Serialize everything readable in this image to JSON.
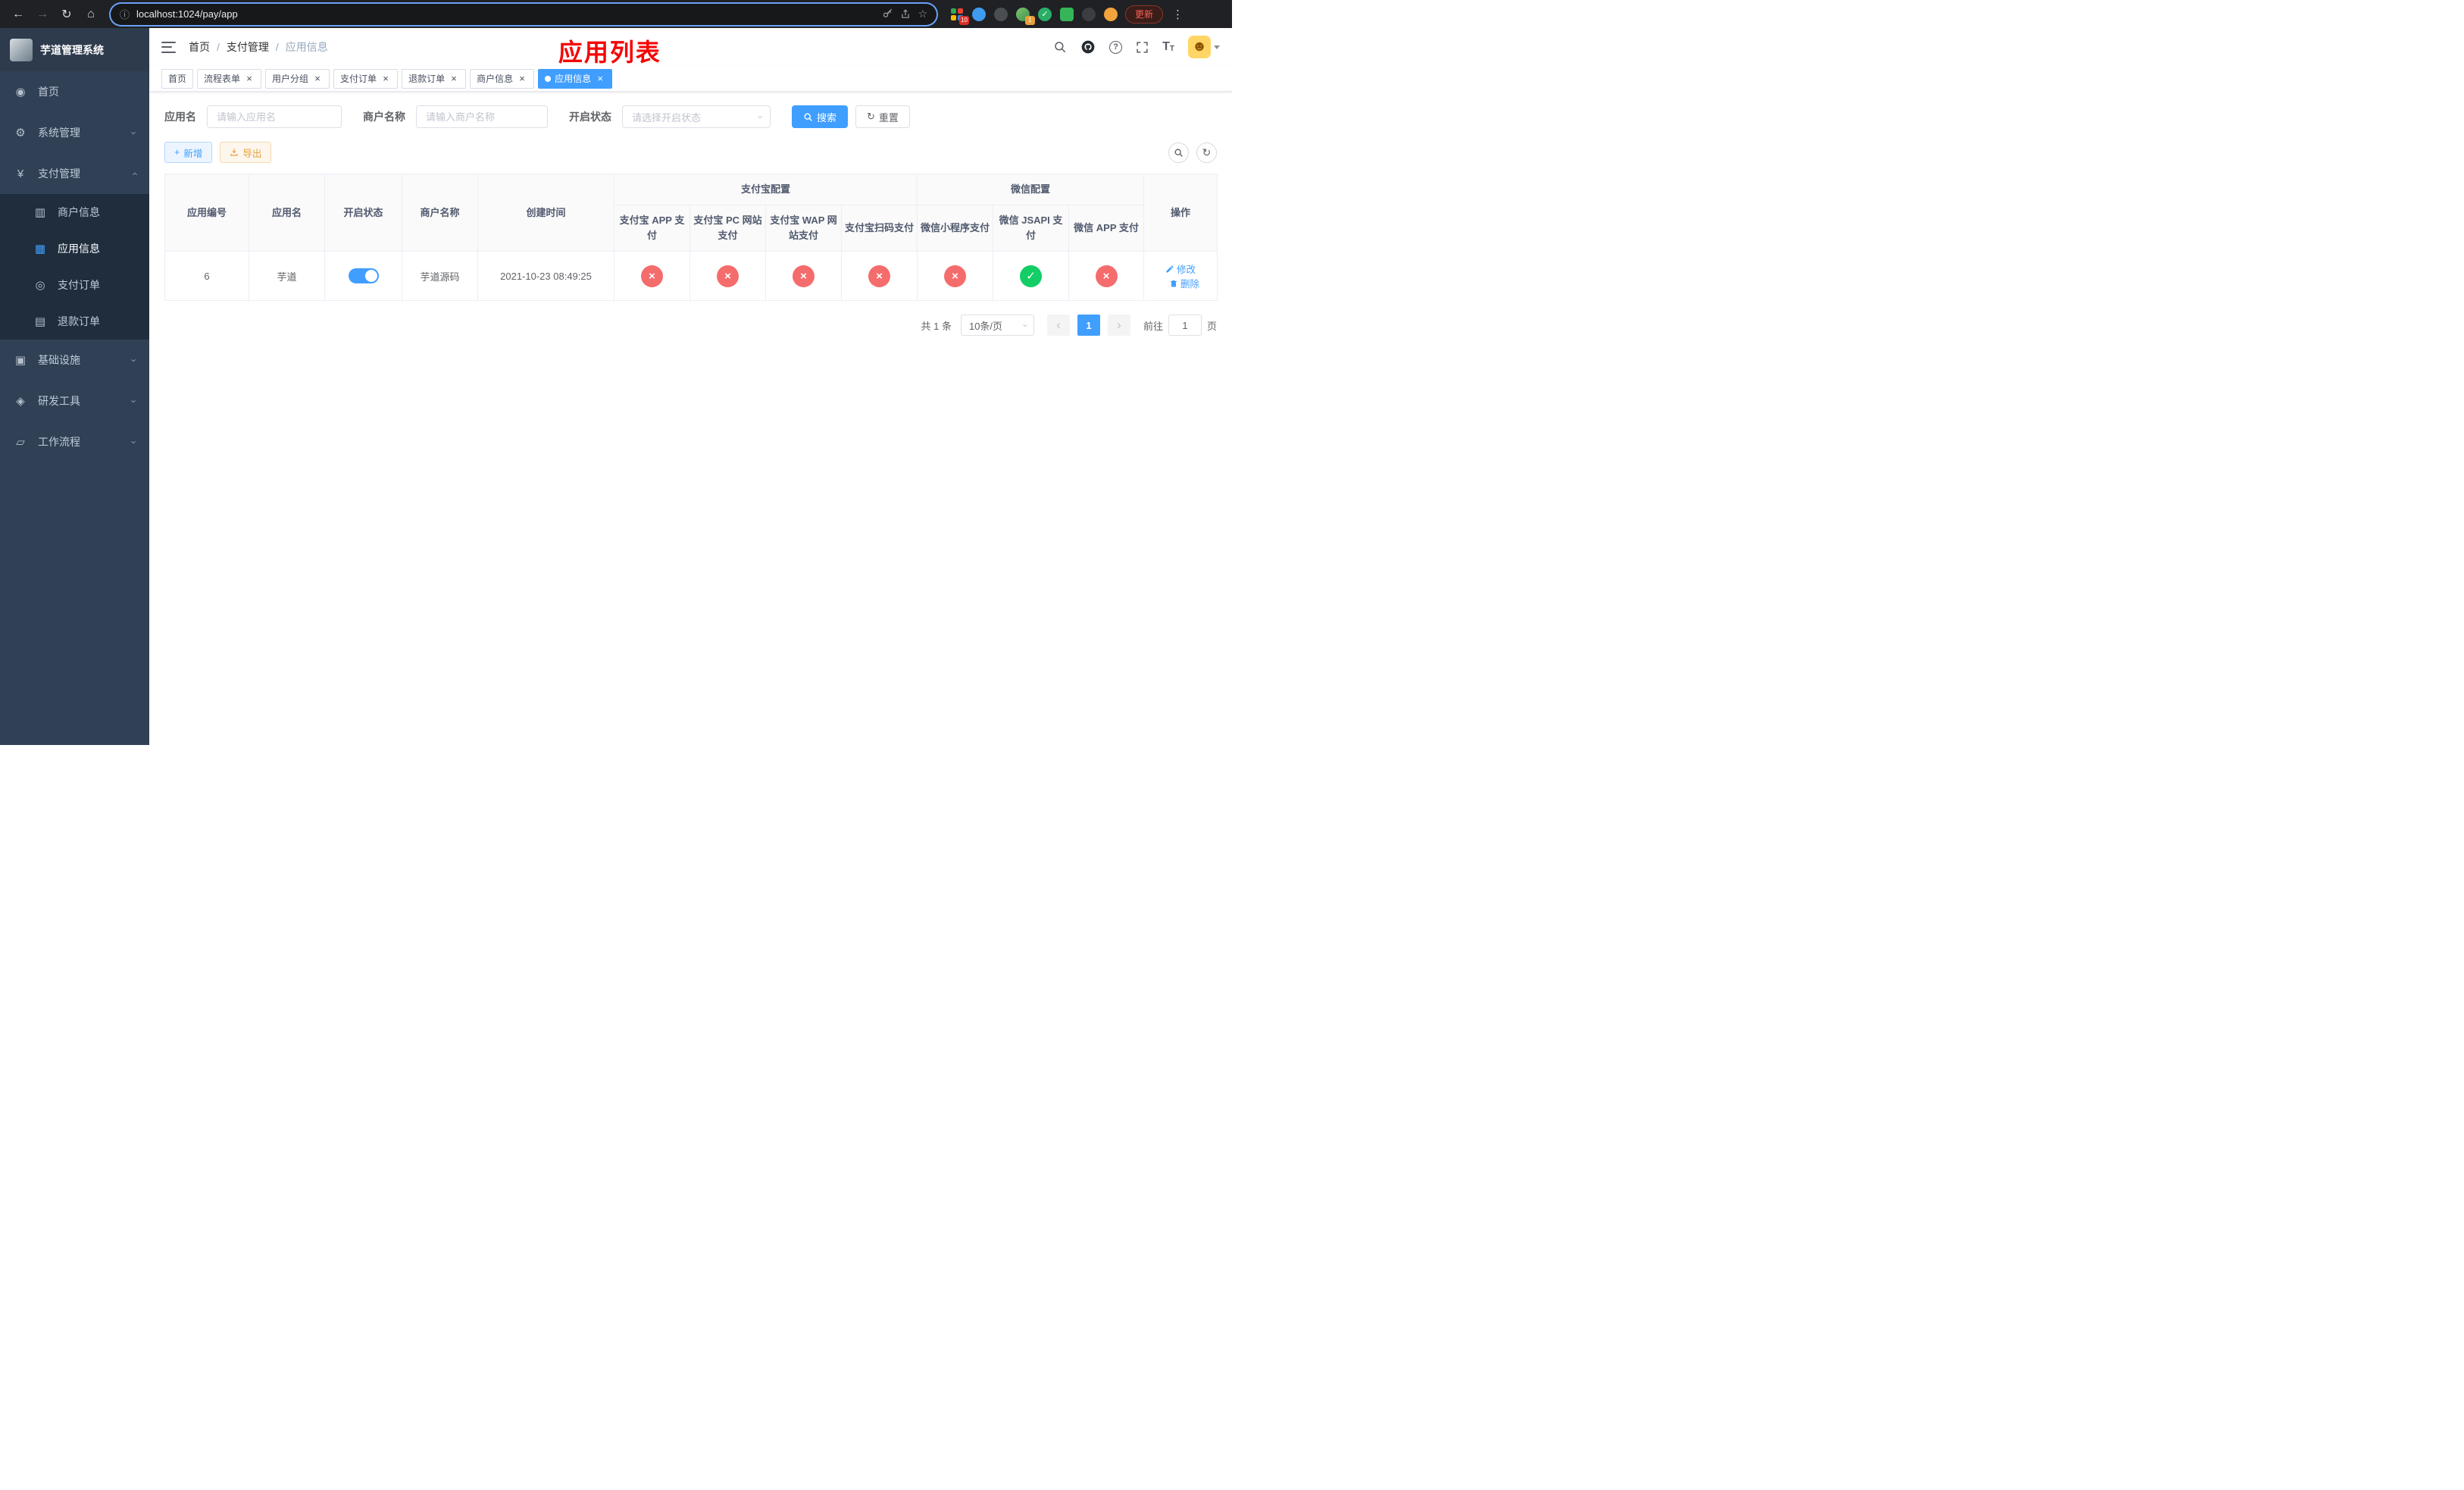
{
  "browser": {
    "back_icon": "←",
    "forward_icon": "→",
    "reload_icon": "↻",
    "home_icon": "⌂",
    "info_icon": "ⓘ",
    "url": "localhost:1024/pay/app",
    "star_icon": "☆",
    "ext_badge_grid": "10",
    "ext_badge_avatar": "1",
    "ext_check": "✓",
    "update_label": "更新",
    "menu_icon": "⋮"
  },
  "sidebar": {
    "app_title": "芋道管理系统",
    "chevron": "›",
    "items": [
      {
        "label": "首页",
        "icon": "◉",
        "expandable": false
      },
      {
        "label": "系统管理",
        "icon": "⚙",
        "expandable": true
      },
      {
        "label": "支付管理",
        "icon": "¥",
        "expandable": true,
        "expanded": true
      },
      {
        "label": "基础设施",
        "icon": "▣",
        "expandable": true
      },
      {
        "label": "研发工具",
        "icon": "◈",
        "expandable": true
      },
      {
        "label": "工作流程",
        "icon": "▱",
        "expandable": true
      }
    ],
    "submenu": [
      {
        "label": "商户信息",
        "icon": "▥",
        "active": false
      },
      {
        "label": "应用信息",
        "icon": "▦",
        "active": true
      },
      {
        "label": "支付订单",
        "icon": "◎",
        "active": false
      },
      {
        "label": "退款订单",
        "icon": "▤",
        "active": false
      }
    ]
  },
  "navbar": {
    "breadcrumb": [
      "首页",
      "支付管理",
      "应用信息"
    ],
    "separator": "/",
    "annotation": "应用列表",
    "question_glyph": "?",
    "textsize_glyph": "T",
    "avatar_glyph": "☻"
  },
  "close_glyph": "×",
  "tabs": [
    {
      "label": "首页",
      "closable": false,
      "active": false
    },
    {
      "label": "流程表单",
      "closable": true,
      "active": false
    },
    {
      "label": "用户分组",
      "closable": true,
      "active": false
    },
    {
      "label": "支付订单",
      "closable": true,
      "active": false
    },
    {
      "label": "退款订单",
      "closable": true,
      "active": false
    },
    {
      "label": "商户信息",
      "closable": true,
      "active": false
    },
    {
      "label": "应用信息",
      "closable": true,
      "active": true
    }
  ],
  "filter": {
    "app_name_label": "应用名",
    "app_name_placeholder": "请输入应用名",
    "merchant_label": "商户名称",
    "merchant_placeholder": "请输入商户名称",
    "status_label": "开启状态",
    "status_placeholder": "请选择开启状态",
    "search_label": "搜索",
    "reset_label": "重置",
    "reset_icon": "↻",
    "select_caret": "›"
  },
  "toolbar": {
    "add_label": "新增",
    "add_icon": "+",
    "export_label": "导出",
    "refresh_icon": "↻"
  },
  "table": {
    "columns": {
      "app_id": "应用编号",
      "app_name": "应用名",
      "status": "开启状态",
      "merchant": "商户名称",
      "created": "创建时间",
      "alipay_group": "支付宝配置",
      "wechat_group": "微信配置",
      "actions": "操作"
    },
    "sub_columns": [
      "支付宝 APP 支付",
      "支付宝 PC 网站支付",
      "支付宝 WAP 网站支付",
      "支付宝扫码支付",
      "微信小程序支付",
      "微信 JSAPI 支付",
      "微信 APP 支付"
    ],
    "status_glyphs": {
      "yes": "✓",
      "no": "×"
    },
    "row": {
      "app_id": "6",
      "app_name": "芋道",
      "status_on": true,
      "merchant": "芋道源码",
      "created": "2021-10-23 08:49:25",
      "configs": [
        false,
        false,
        false,
        false,
        false,
        true,
        false
      ],
      "edit_label": "修改",
      "delete_label": "删除"
    }
  },
  "pagination": {
    "total": "共 1 条",
    "page_size": "10条/页",
    "size_caret": "›",
    "prev_icon": "‹",
    "page": "1",
    "next_icon": "›",
    "goto_prefix": "前往",
    "goto_value": "1",
    "goto_suffix": "页"
  }
}
